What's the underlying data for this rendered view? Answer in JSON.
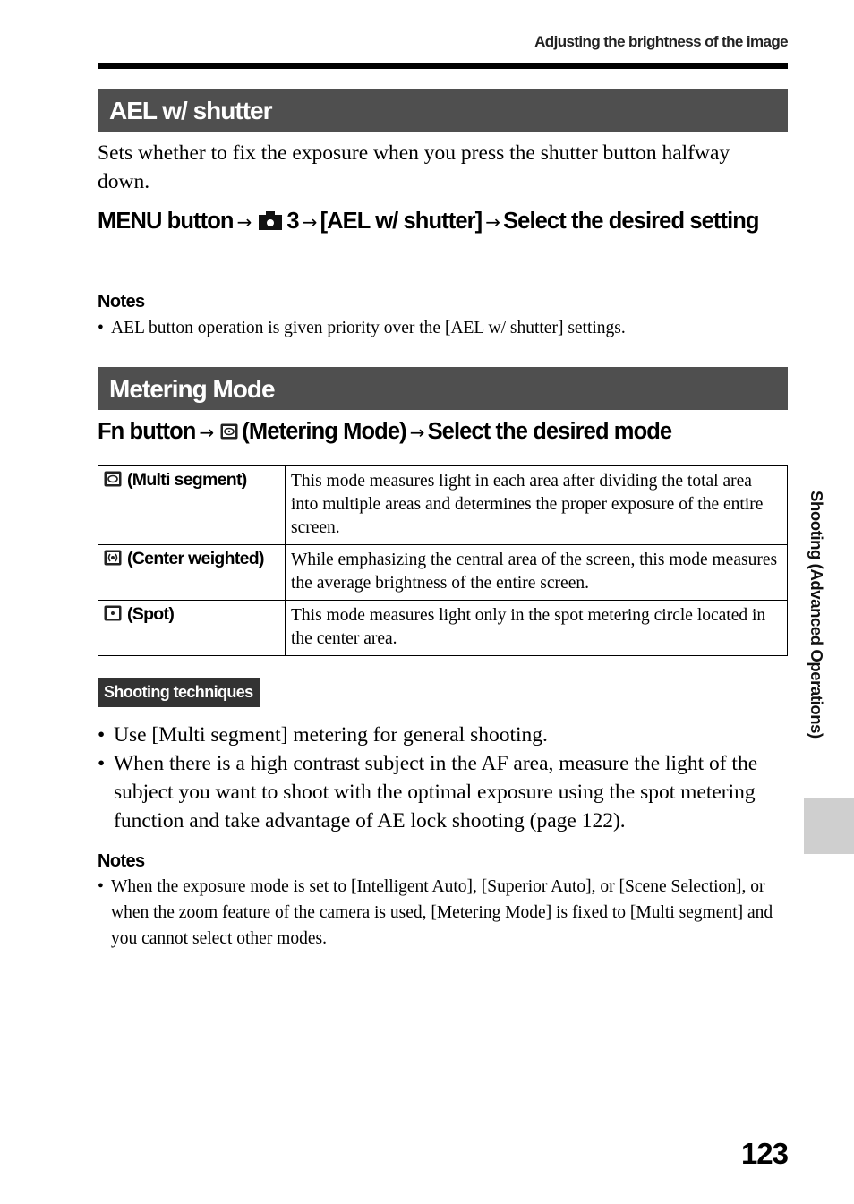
{
  "running_head": "Adjusting the brightness of the image",
  "sections": {
    "ael": {
      "title": "AEL w/ shutter",
      "description": "Sets whether to fix the exposure when you press the shutter button halfway down.",
      "procedure": {
        "step1": "MENU button",
        "icon": "camera-icon",
        "step2_suffix": "3",
        "step3": "[AEL w/ shutter]",
        "step4": "Select the desired setting"
      },
      "notes_title": "Notes",
      "notes": [
        "AEL button operation is given priority over the [AEL w/ shutter] settings."
      ]
    },
    "metering": {
      "title": "Metering Mode",
      "procedure": {
        "step1": "Fn button",
        "icon": "metering-mode-icon",
        "step2": "(Metering Mode)",
        "step3": "Select the desired mode"
      },
      "table": [
        {
          "icon": "multi-segment-icon",
          "mode": "(Multi segment)",
          "description": "This mode measures light in each area after dividing the total area into multiple areas and determines the proper exposure of the entire screen."
        },
        {
          "icon": "center-weighted-icon",
          "mode": "(Center weighted)",
          "description": "While emphasizing the central area of the screen, this mode measures the average brightness of the entire screen."
        },
        {
          "icon": "spot-icon",
          "mode": "(Spot)",
          "description": "This mode measures light only in the spot metering circle located in the center area."
        }
      ],
      "techniques_label": "Shooting techniques",
      "techniques": [
        "Use [Multi segment] metering for general shooting.",
        "When there is a high contrast subject in the AF area, measure the light of the subject you want to shoot with the optimal exposure using the spot metering function and take advantage of AE lock shooting (page 122)."
      ],
      "notes_title": "Notes",
      "notes": [
        "When the exposure mode is set to [Intelligent Auto], [Superior Auto], or [Scene Selection], or when the zoom feature of the camera is used, [Metering Mode] is fixed to [Multi segment] and you cannot select other modes."
      ]
    }
  },
  "side_tab": "Shooting (Advanced Operations)",
  "page_number": "123",
  "arrow_glyph": "→",
  "colors": {
    "section_bar": "#4f4f4f",
    "badge": "#333333",
    "side_tab_box": "#cfcfcf"
  }
}
